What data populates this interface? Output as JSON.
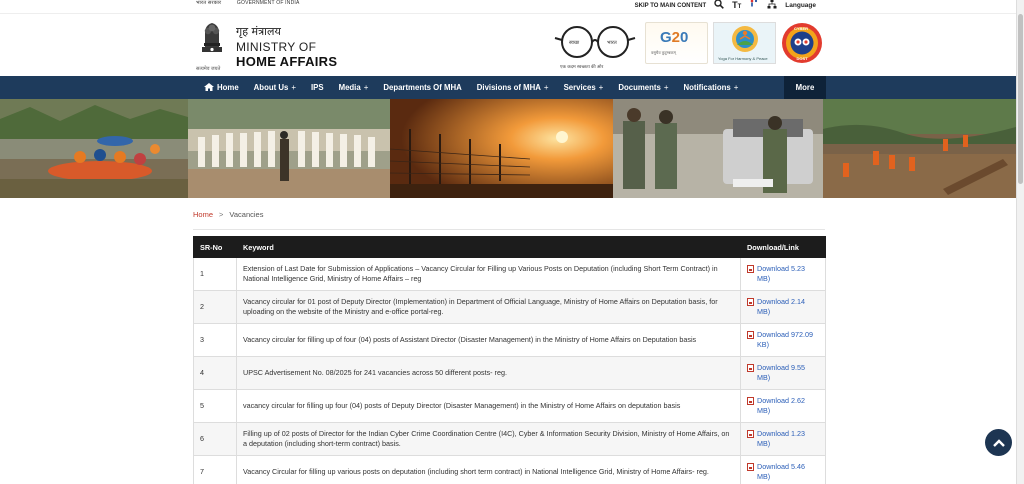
{
  "util": {
    "left_hindi": "भारत सरकार",
    "left_english": "GOVERNMENT OF INDIA",
    "skip": "SKIP TO MAIN CONTENT",
    "language": "Language"
  },
  "header": {
    "hindi_name": "गृह मंत्रालय",
    "line1": "MINISTRY OF",
    "line2": "HOME AFFAIRS",
    "motto": "सत्यमेव जयते",
    "swachh_caption": "एक कदम स्वच्छता की ओर",
    "g20_caption": "वसुधैव कुटुम्बकम्",
    "yoga_caption": "Yoga For Harmony & Peace"
  },
  "nav": {
    "items": [
      {
        "label": "Home",
        "plus": ""
      },
      {
        "label": "About Us",
        "plus": "+"
      },
      {
        "label": "IPS",
        "plus": ""
      },
      {
        "label": "Media",
        "plus": "+"
      },
      {
        "label": "Departments Of MHA",
        "plus": ""
      },
      {
        "label": "Divisions of MHA",
        "plus": "+"
      },
      {
        "label": "Services",
        "plus": "+"
      },
      {
        "label": "Documents",
        "plus": "+"
      },
      {
        "label": "Notifications",
        "plus": "+"
      }
    ],
    "more": "More"
  },
  "breadcrumb": {
    "home": "Home",
    "separator": ">",
    "current": "Vacancies"
  },
  "table": {
    "headers": [
      "SR-No",
      "Keyword",
      "Download/Link"
    ],
    "rows": [
      {
        "sr": "1",
        "keyword": "Extension of Last Date for Submission of Applications – Vacancy Circular for Filling up Various Posts on Deputation (including Short Term Contract) in National Intelligence Grid, Ministry of Home Affairs – reg",
        "link": "Download 5.23 MB)"
      },
      {
        "sr": "2",
        "keyword": "Vacancy circular for 01 post of Deputy Director (Implementation) in Department of Official Language, Ministry of Home Affairs on Deputation basis, for uploading on the website of the Ministry and e-office portal-reg.",
        "link": "Download 2.14 MB)"
      },
      {
        "sr": "3",
        "keyword": "Vacancy circular for filling up of four (04) posts of Assistant Director (Disaster Management) in the Ministry of Home Affairs on Deputation basis",
        "link": "Download 972.09 KB)"
      },
      {
        "sr": "4",
        "keyword": "UPSC Advertisement No. 08/2025 for 241 vacancies across 50 different posts- reg.",
        "link": "Download 9.55 MB)"
      },
      {
        "sr": "5",
        "keyword": "vacancy circular for filling up four (04) posts of Deputy Director (Disaster Management) in the Ministry of Home Affairs on deputation basis",
        "link": "Download 2.62 MB)"
      },
      {
        "sr": "6",
        "keyword": "Filling up of 02 posts of Director for the Indian Cyber Crime Coordination Centre (I4C), Cyber & Information Security Division, Ministry of Home Affairs, on a deputation (including short-term contract) basis.",
        "link": "Download 1.23 MB)"
      },
      {
        "sr": "7",
        "keyword": "Vacancy Circular for filling up various posts on deputation (including short term contract) in National Intelligence Grid, Ministry of Home Affairs- reg.",
        "link": "Download 5.46 MB)"
      }
    ]
  },
  "colors": {
    "nav_bg": "#1e3b5c",
    "more_bg": "#0e2238",
    "table_header_bg": "#1c1c1c",
    "link": "#2c5fb8",
    "breadcrumb_home": "#c0392b"
  }
}
